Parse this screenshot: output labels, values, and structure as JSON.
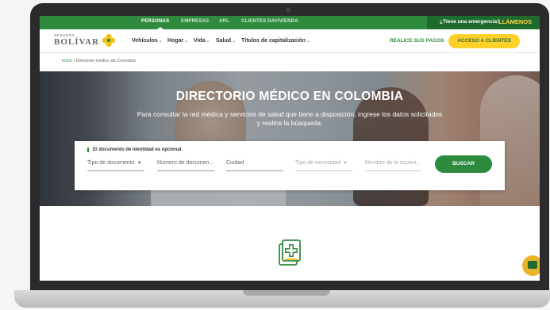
{
  "topbar": {
    "links": [
      "PERSONAS",
      "EMPRESAS",
      "ARL",
      "CLIENTES DAVIVIENDA"
    ],
    "emergency_question": "¿Tiene una emergencia?",
    "emergency_cta": "LLÁMENOS"
  },
  "brand": {
    "small": "SEGUROS",
    "name": "BOLÍVAR"
  },
  "nav": {
    "items": [
      "Vehículos",
      "Hogar",
      "Vida",
      "Salud",
      "Títulos de capitalización"
    ],
    "payments": "REALICE SUS PAGOS",
    "access": "ACCESO A CLIENTES"
  },
  "breadcrumb": {
    "home": "Inicio",
    "separator": "/",
    "current": "Directorio médico de Colombia"
  },
  "hero": {
    "title": "DIRECTORIO MÉDICO EN COLOMBIA",
    "subtitle": "Para consultar la red médica y servicios de salud que tiene a disposición, ingrese los datos solicitados y realice la búsqueda."
  },
  "search": {
    "note": "El documento de identidad es opcional.",
    "doc_type": "Tipo de documento",
    "doc_number": "Número de documen...",
    "city": "Ciudad",
    "need_type": "Tipo de necesidad",
    "specialty": "Nombre de la especi...",
    "button": "BUSCAR"
  },
  "colors": {
    "green": "#2e8b3e",
    "yellow": "#ffd12a",
    "dark_green": "#1f6b2d"
  },
  "icons": [
    "flower-logo-icon",
    "medical-document-icon",
    "chat-icon",
    "chevron-down-icon"
  ]
}
